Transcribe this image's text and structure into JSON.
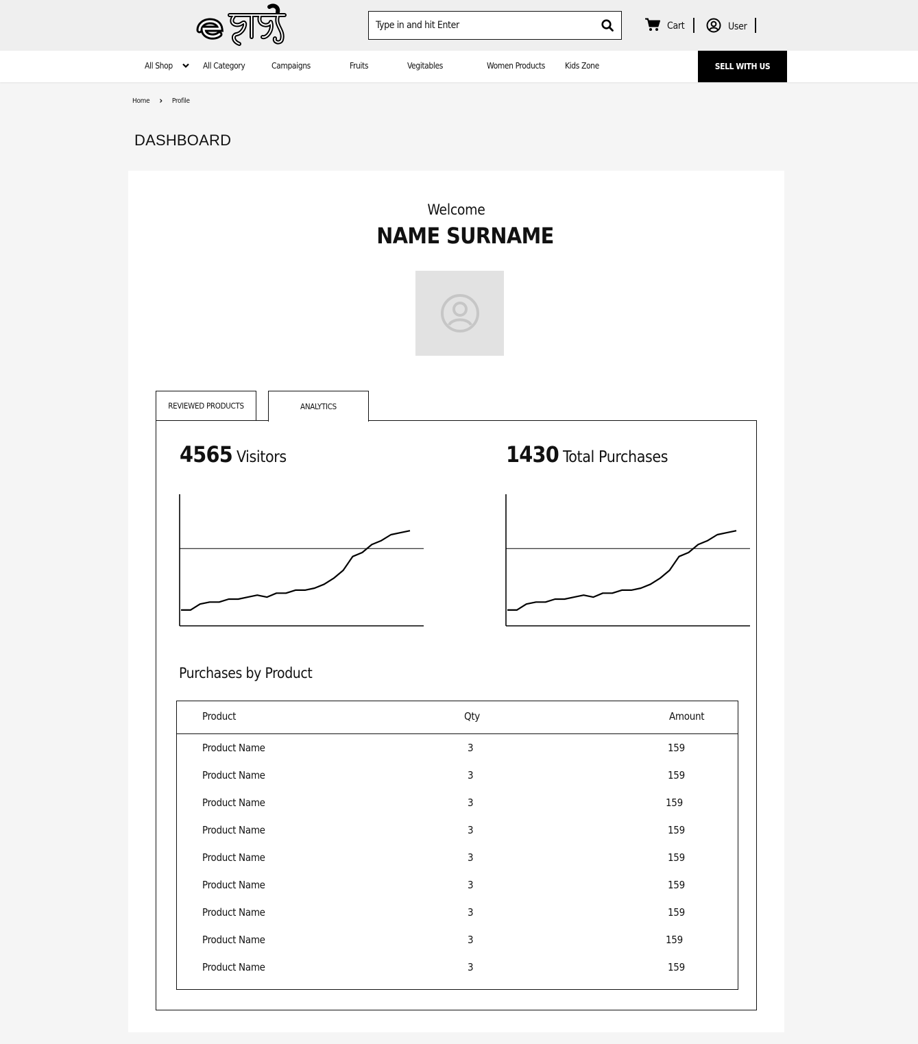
{
  "header": {
    "logo_text": "e হাট",
    "search_placeholder": "Type in and hit Enter",
    "cart_label": "Cart",
    "user_label": "User"
  },
  "nav": {
    "items": [
      {
        "label": "All Shop"
      },
      {
        "label": "All Category"
      },
      {
        "label": "Campaigns"
      },
      {
        "label": "Fruits"
      },
      {
        "label": "Vegitables"
      },
      {
        "label": "Women Products"
      },
      {
        "label": "Kids Zone"
      }
    ],
    "sell_label": "SELL WITH US"
  },
  "breadcrumb": {
    "home": "Home",
    "separator": "›",
    "current": "Profile"
  },
  "page_title": "DASHBOARD",
  "profile": {
    "welcome": "Welcome",
    "name": "NAME SURNAME"
  },
  "tabs": [
    {
      "label": "REVIEWED PRODUCTS",
      "active": false
    },
    {
      "label": "ANALYTICS",
      "active": true
    }
  ],
  "stats": {
    "visitors": {
      "value": "4565",
      "label": "Visitors"
    },
    "purchases": {
      "value": "1430",
      "label": "Total Purchases"
    }
  },
  "chart_data": [
    {
      "type": "line",
      "title": "",
      "x": [
        0,
        1,
        2,
        3,
        4,
        5,
        6,
        7,
        8,
        9,
        10,
        11,
        12,
        13,
        14,
        15,
        16,
        17,
        18,
        19,
        20,
        21,
        22,
        23,
        24
      ],
      "series": [
        {
          "values": [
            3,
            3,
            6,
            7,
            7,
            8.5,
            8.5,
            9.5,
            10.5,
            9.5,
            11.5,
            11.5,
            13,
            13,
            14,
            16,
            19,
            23,
            30,
            32,
            36,
            38,
            41,
            42,
            43
          ]
        }
      ],
      "reference_line": 34,
      "ylim": [
        -5,
        60
      ],
      "grid": false
    },
    {
      "type": "line",
      "title": "",
      "x": [
        0,
        1,
        2,
        3,
        4,
        5,
        6,
        7,
        8,
        9,
        10,
        11,
        12,
        13,
        14,
        15,
        16,
        17,
        18,
        19,
        20,
        21,
        22,
        23,
        24
      ],
      "series": [
        {
          "values": [
            3,
            3,
            6,
            7,
            7,
            8.5,
            8.5,
            9.5,
            10.5,
            9.5,
            11.5,
            11.5,
            13,
            13,
            14,
            16,
            19,
            23,
            30,
            32,
            36,
            38,
            41,
            42,
            43
          ]
        }
      ],
      "reference_line": 34,
      "ylim": [
        -5,
        60
      ],
      "grid": false
    }
  ],
  "purchases_table": {
    "title": "Purchases by Product",
    "columns": [
      "Product",
      "Qty",
      "Amount"
    ],
    "rows": [
      [
        "Product Name",
        "3",
        "159"
      ],
      [
        "Product Name",
        "3",
        "159"
      ],
      [
        "Product Name",
        "3",
        "159"
      ],
      [
        "Product Name",
        "3",
        "159"
      ],
      [
        "Product Name",
        "3",
        "159"
      ],
      [
        "Product Name",
        "3",
        "159"
      ],
      [
        "Product Name",
        "3",
        "159"
      ],
      [
        "Product Name",
        "3",
        "159"
      ],
      [
        "Product Name",
        "3",
        "159"
      ]
    ]
  },
  "colors": {
    "accent": "#000000",
    "page_bg": "#f5f5f5",
    "topbar_bg": "#efefef",
    "avatar_bg": "#e2e2e2"
  },
  "icons": {
    "search": "search-icon",
    "cart": "cart-icon",
    "user": "user-circle-icon",
    "dropdown": "chevron-down-icon",
    "avatar": "avatar-placeholder-icon"
  }
}
